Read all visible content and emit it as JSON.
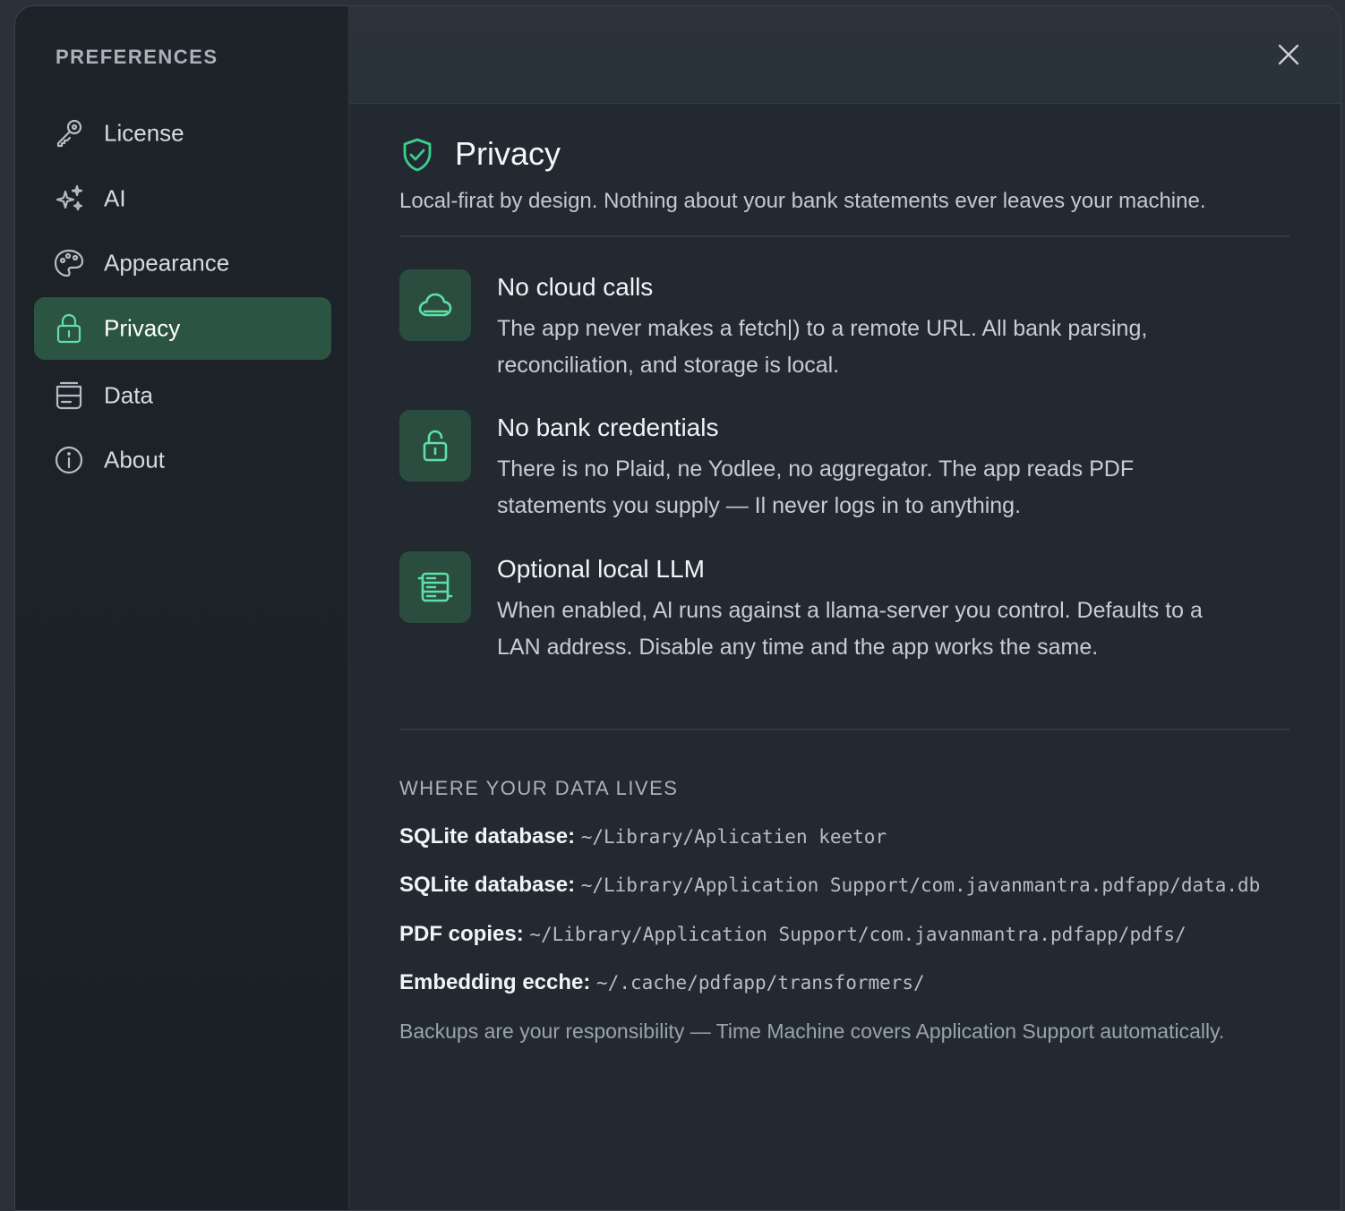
{
  "sidebar": {
    "heading": "PREFERENCES",
    "items": [
      {
        "label": "License",
        "icon": "key-icon"
      },
      {
        "label": "AI",
        "icon": "sparkle-icon"
      },
      {
        "label": "Appearance",
        "icon": "palette-icon"
      },
      {
        "label": "Privacy",
        "icon": "lock-icon",
        "active": true
      },
      {
        "label": "Data",
        "icon": "database-icon"
      },
      {
        "label": "About",
        "icon": "info-icon"
      }
    ]
  },
  "header": {
    "close_icon": "close-icon"
  },
  "main": {
    "title": "Privacy",
    "title_icon": "shield-check-icon",
    "subtitle": "Local-firat by design. Nothing about your bank statements ever leaves your machine.",
    "features": [
      {
        "icon": "cloud-icon",
        "title": "No cloud calls",
        "description": "The app never makes a fetch|) to a remote URL. All bank parsing, reconciliation, and storage is local."
      },
      {
        "icon": "unlock-icon",
        "title": "No bank credentials",
        "description": "There is no Plaid, ne Yodlee, no aggregator. The app reads PDF statements you supply — Il never logs in to anything."
      },
      {
        "icon": "server-icon",
        "title": "Optional local LLM",
        "description": "When enabled, Al runs against a llama-server you control. Defaults to a LAN address. Disable any time and the app works the same."
      }
    ],
    "data_section": {
      "heading": "WHERE YOUR DATA LIVES",
      "rows": [
        {
          "label": "SQLite database:",
          "value": "~/Library/Aplicatien keetor"
        },
        {
          "label": "SQLite database:",
          "value": "~/Library/Application Support/com.javanmantra.pdfapp/data.db"
        },
        {
          "label": "PDF copies:",
          "value": "~/Library/Application Support/com.javanmantra.pdfapp/pdfs/"
        },
        {
          "label": "Embedding ecche:",
          "value": "~/.cache/pdfapp/transformers/"
        }
      ],
      "footer": "Backups are your responsibility — Time Machine covers Application Support automatically."
    }
  },
  "colors": {
    "accent": "#3ccf8e",
    "active_nav_bg": "#2b5443",
    "icon_box_bg": "#2a4d40"
  }
}
